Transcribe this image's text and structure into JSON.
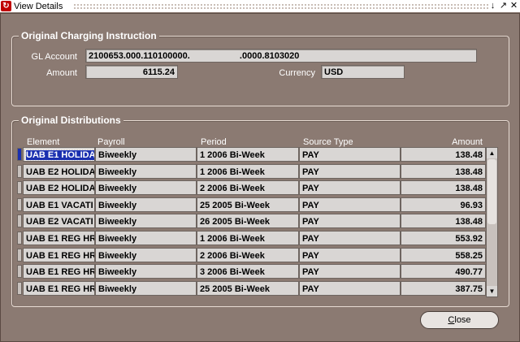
{
  "window": {
    "title": "View Details"
  },
  "charging": {
    "group_label": "Original Charging Instruction",
    "gl_label": "GL Account",
    "gl_value": "2100653.000.110100000.                    .0000.8103020",
    "amount_label": "Amount",
    "amount_value": "6115.24",
    "currency_label": "Currency",
    "currency_value": "USD"
  },
  "distributions": {
    "group_label": "Original Distributions",
    "headers": [
      "Element",
      "Payroll",
      "Period",
      "Source Type",
      "Amount"
    ],
    "rows": [
      [
        "UAB E1 HOLIDA",
        "Biweekly",
        "1 2006 Bi-Week",
        "PAY",
        "138.48"
      ],
      [
        "UAB E2 HOLIDA",
        "Biweekly",
        "1 2006 Bi-Week",
        "PAY",
        "138.48"
      ],
      [
        "UAB E2 HOLIDA",
        "Biweekly",
        "2 2006 Bi-Week",
        "PAY",
        "138.48"
      ],
      [
        "UAB E1 VACATI",
        "Biweekly",
        "25 2005 Bi-Week",
        "PAY",
        "96.93"
      ],
      [
        "UAB E2 VACATI",
        "Biweekly",
        "26 2005 Bi-Week",
        "PAY",
        "138.48"
      ],
      [
        "UAB E1 REG HR",
        "Biweekly",
        "1 2006 Bi-Week",
        "PAY",
        "553.92"
      ],
      [
        "UAB E1 REG HR",
        "Biweekly",
        "2 2006 Bi-Week",
        "PAY",
        "558.25"
      ],
      [
        "UAB E1 REG HR",
        "Biweekly",
        "3 2006 Bi-Week",
        "PAY",
        "490.77"
      ],
      [
        "UAB E1 REG HR",
        "Biweekly",
        "25 2005 Bi-Week",
        "PAY",
        "387.75"
      ]
    ]
  },
  "buttons": {
    "close_mnemonic": "C",
    "close_rest": "lose"
  }
}
